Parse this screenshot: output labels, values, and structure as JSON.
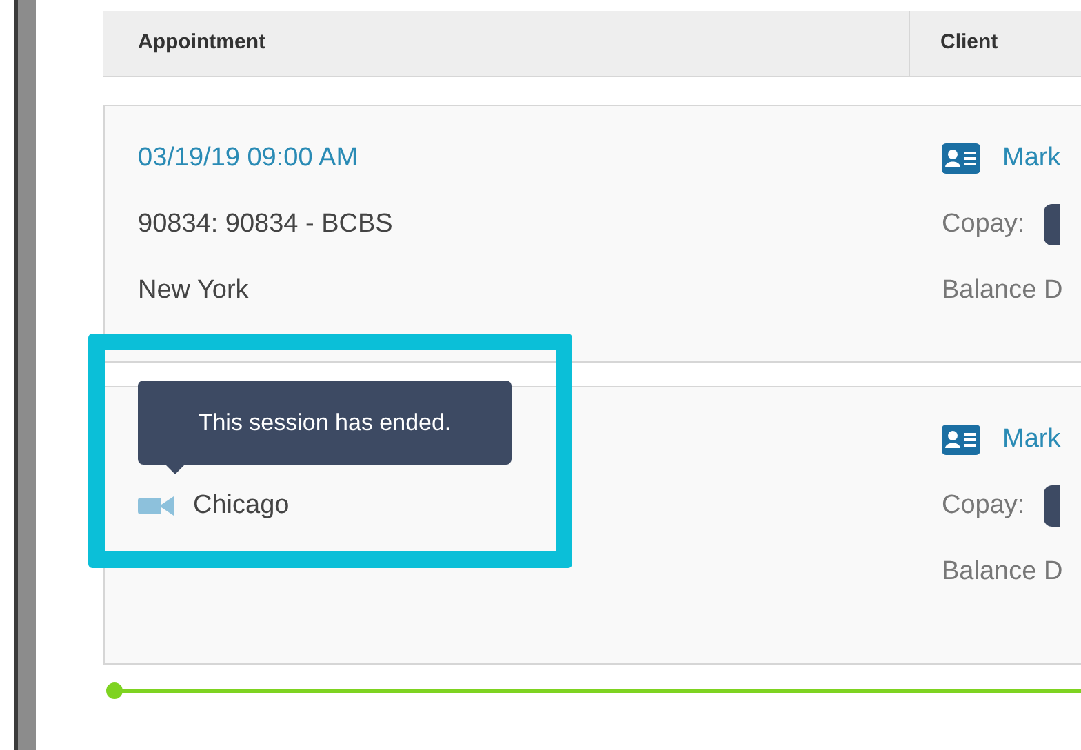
{
  "table": {
    "columns": [
      {
        "label": "Appointment"
      },
      {
        "label": "Client"
      }
    ],
    "rows": [
      {
        "time": "03/19/19 09:00 AM",
        "service": "90834: 90834 - BCBS",
        "location": "New York",
        "video": false,
        "highlighted": false,
        "client": "Mark",
        "copay_label": "Copay:",
        "balance_label": "Balance D"
      },
      {
        "location": "Chicago",
        "video": true,
        "highlighted": true,
        "tooltip": "This session has ended.",
        "client": "Mark",
        "copay_label": "Copay:",
        "balance_label": "Balance D"
      }
    ]
  }
}
